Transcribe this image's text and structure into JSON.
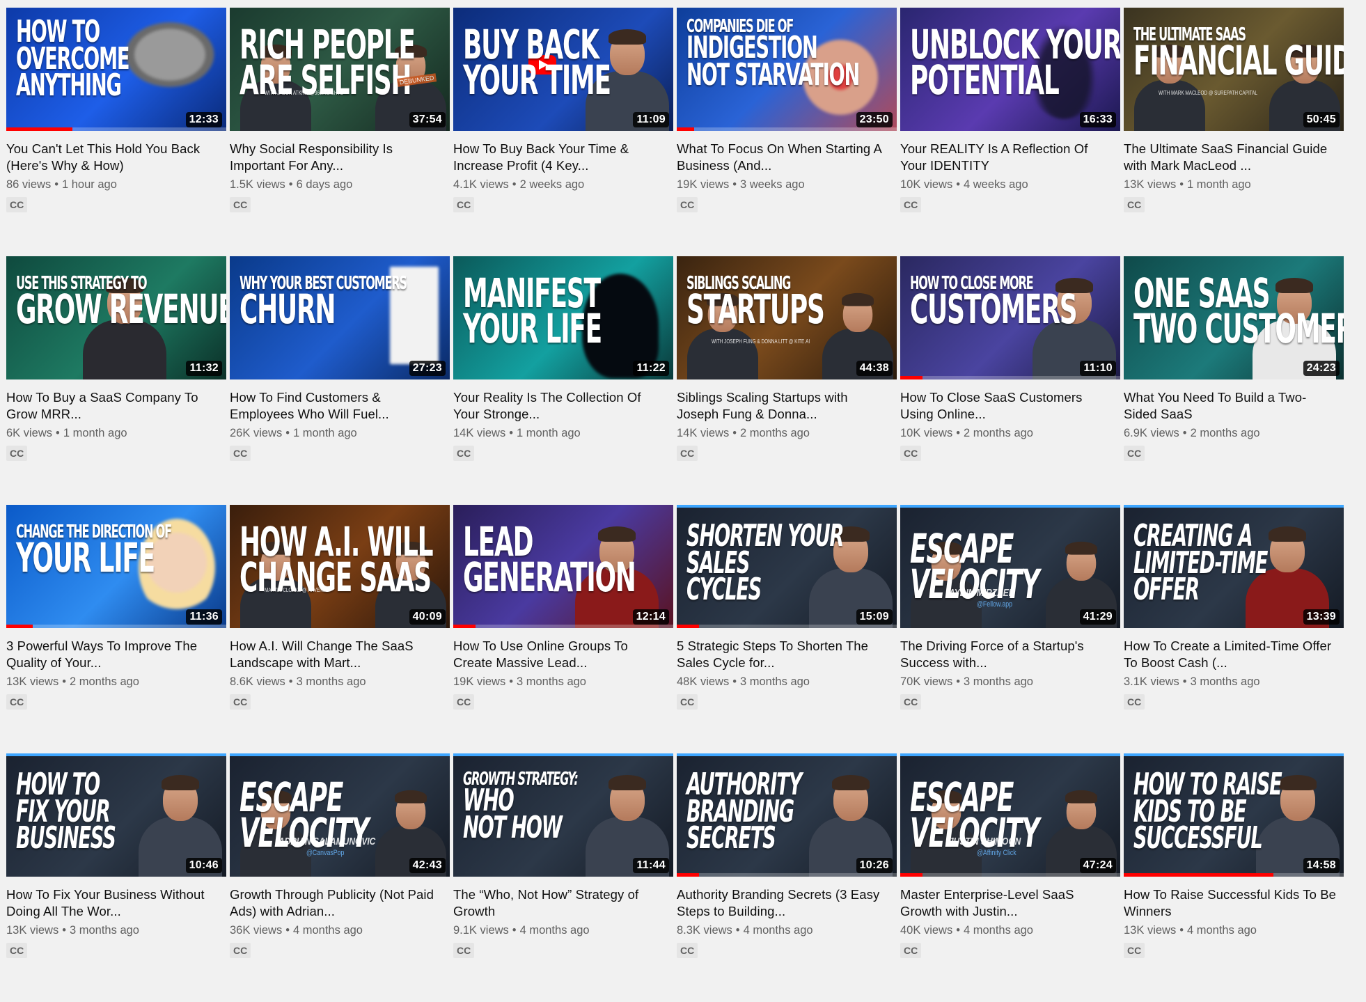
{
  "videos": [
    {
      "title": "You Can't Let This Hold You Back (Here's Why & How)",
      "views": "86 views",
      "age": "1 hour ago",
      "duration": "12:33",
      "cc": "CC",
      "thumb_lines": [
        "HOW TO",
        "OVERCOME",
        "ANYTHING"
      ],
      "thumb_credit": "",
      "progress": 0.3,
      "topline": false,
      "bg": "linear-gradient(135deg,#0d3aa8,#1e5ee8 55%,#0a2a7a)",
      "accent": "#ffffff",
      "art": "elephant"
    },
    {
      "title": "Why Social Responsibility Is Important For Any...",
      "views": "1.5K views",
      "age": "6 days ago",
      "duration": "37:54",
      "cc": "CC",
      "thumb_lines": [
        "RICH PEOPLE",
        "ARE SELFISH"
      ],
      "thumb_credit": "WITH JASON ATKINS @360INSIGHTS",
      "progress": 0,
      "topline": false,
      "bg": "linear-gradient(135deg,#1b3b2f,#2e5a45 50%,#14281f)",
      "accent": "#ffffff",
      "art": "two",
      "badge": "DEBUNKED"
    },
    {
      "title": "How To Buy Back Your Time & Increase Profit (4 Key...",
      "views": "4.1K views",
      "age": "2 weeks ago",
      "duration": "11:09",
      "cc": "CC",
      "thumb_lines": [
        "BUY BACK",
        "YOUR TIME"
      ],
      "thumb_credit": "",
      "progress": 0,
      "topline": false,
      "bg": "linear-gradient(135deg,#0c2c7a,#1d4bb8 60%,#0b1f55)",
      "accent": "#ffffff",
      "art": "man-right"
    },
    {
      "title": "What To Focus On When Starting A Business (And...",
      "views": "19K views",
      "age": "3 weeks ago",
      "duration": "23:50",
      "cc": "CC",
      "thumb_lines": [
        "COMPANIES DIE OF",
        "INDIGESTION",
        "NOT STARVATION"
      ],
      "thumb_credit": "",
      "progress": 0.08,
      "topline": false,
      "bg": "linear-gradient(135deg,#0e3e9a,#2a63d6 50%,#b04a5a)",
      "accent": "#ffffff",
      "art": "stomach"
    },
    {
      "title": "Your REALITY Is A Reflection Of Your IDENTITY",
      "views": "10K views",
      "age": "4 weeks ago",
      "duration": "16:33",
      "cc": "CC",
      "thumb_lines": [
        "UNBLOCK YOUR",
        "POTENTIAL"
      ],
      "thumb_credit": "",
      "progress": 0,
      "topline": false,
      "bg": "linear-gradient(135deg,#2a2670,#5a3bb0 55%,#1c1850)",
      "accent": "#ffffff",
      "art": "rabbit"
    },
    {
      "title": "The Ultimate SaaS Financial Guide with Mark MacLeod ...",
      "views": "13K views",
      "age": "1 month ago",
      "duration": "50:45",
      "cc": "CC",
      "thumb_lines": [
        "THE ULTIMATE SAAS",
        "FINANCIAL GUIDE"
      ],
      "thumb_credit": "WITH MARK MACLEOD @ SUREPATH CAPITAL",
      "progress": 0,
      "topline": false,
      "bg": "linear-gradient(135deg,#3a3320,#6a5a30 50%,#2a2418)",
      "accent": "#ffffff",
      "art": "two"
    },
    {
      "title": "How To Buy a SaaS Company To Grow MRR...",
      "views": "6K views",
      "age": "1 month ago",
      "duration": "11:32",
      "cc": "CC",
      "thumb_lines": [
        "USE THIS STRATEGY TO",
        "GROW REVENUE"
      ],
      "thumb_credit": "",
      "progress": 0,
      "topline": false,
      "bg": "linear-gradient(135deg,#0f4a3e,#1e7a62 55%,#0b3028)",
      "accent": "#ffffff",
      "art": "man-center"
    },
    {
      "title": "How To Find Customers & Employees Who Will Fuel...",
      "views": "26K views",
      "age": "1 month ago",
      "duration": "27:23",
      "cc": "CC",
      "thumb_lines": [
        "WHY YOUR BEST CUSTOMERS",
        "CHURN"
      ],
      "thumb_credit": "",
      "progress": 0,
      "topline": false,
      "bg": "linear-gradient(135deg,#0a3a8a,#1f5ccc 55%,#0a2a66)",
      "accent": "#ffffff",
      "art": "door"
    },
    {
      "title": "Your Reality Is The Collection Of Your Stronge...",
      "views": "14K views",
      "age": "1 month ago",
      "duration": "11:22",
      "cc": "CC",
      "thumb_lines": [
        "MANIFEST",
        "YOUR LIFE"
      ],
      "thumb_credit": "",
      "progress": 0,
      "topline": false,
      "bg": "linear-gradient(135deg,#0b5a5a,#13a0a0 55%,#0a3a3a)",
      "accent": "#ffffff",
      "art": "head"
    },
    {
      "title": "Siblings Scaling Startups with Joseph Fung & Donna...",
      "views": "14K views",
      "age": "2 months ago",
      "duration": "44:38",
      "cc": "CC",
      "thumb_lines": [
        "SIBLINGS SCALING",
        "STARTUPS"
      ],
      "thumb_credit": "WITH JOSEPH FUNG & DONNA LITT @ KITE.AI",
      "progress": 0,
      "topline": false,
      "bg": "linear-gradient(135deg,#3a2410,#7a4a1c 50%,#2a1a0c)",
      "accent": "#ffffff",
      "art": "two"
    },
    {
      "title": "How To Close SaaS Customers Using Online...",
      "views": "10K views",
      "age": "2 months ago",
      "duration": "11:10",
      "cc": "CC",
      "thumb_lines": [
        "HOW TO CLOSE MORE",
        "CUSTOMERS"
      ],
      "thumb_credit": "",
      "progress": 0.1,
      "topline": false,
      "bg": "linear-gradient(135deg,#2a2860,#4a44a0 55%,#1c1a44)",
      "accent": "#ffffff",
      "art": "man-right"
    },
    {
      "title": "What You Need To Build a Two-Sided SaaS",
      "views": "6.9K views",
      "age": "2 months ago",
      "duration": "24:23",
      "cc": "CC",
      "thumb_lines": [
        "ONE SAAS",
        "TWO CUSTOMERS"
      ],
      "thumb_credit": "",
      "progress": 0,
      "topline": false,
      "bg": "linear-gradient(135deg,#0f4a4a,#1c7a7a 55%,#0b3030)",
      "accent": "#ffffff",
      "art": "face"
    },
    {
      "title": "3 Powerful Ways To Improve The Quality of Your...",
      "views": "13K views",
      "age": "2 months ago",
      "duration": "11:36",
      "cc": "CC",
      "thumb_lines": [
        "CHANGE THE DIRECTION OF",
        "YOUR LIFE"
      ],
      "thumb_credit": "",
      "progress": 0.12,
      "topline": false,
      "bg": "linear-gradient(135deg,#0b5ac8,#2f8cf0 55%,#0a3a8a)",
      "accent": "#ffffff",
      "art": "woman"
    },
    {
      "title": "How A.I. Will Change The SaaS Landscape with Mart...",
      "views": "8.6K views",
      "age": "3 months ago",
      "duration": "40:09",
      "cc": "CC",
      "thumb_lines": [
        "HOW A.I. WILL",
        "CHANGE SAAS"
      ],
      "thumb_credit": "MARTIN CLOAKE @ RAVEN.AI",
      "progress": 0,
      "topline": false,
      "bg": "linear-gradient(135deg,#3a1e0c,#7a3e14 50%,#2a160a)",
      "accent": "#ffffff",
      "art": "two"
    },
    {
      "title": "How To Use Online Groups To Create Massive Lead...",
      "views": "19K views",
      "age": "3 months ago",
      "duration": "12:14",
      "cc": "CC",
      "thumb_lines": [
        "LEAD",
        "GENERATION"
      ],
      "thumb_credit": "",
      "progress": 0.1,
      "topline": false,
      "bg": "linear-gradient(135deg,#2a1e5a,#4a3aa0 50%,#5a1220)",
      "accent": "#ffffff",
      "art": "man-red"
    },
    {
      "title": "5 Strategic Steps To Shorten The Sales Cycle for...",
      "views": "48K views",
      "age": "3 months ago",
      "duration": "15:09",
      "cc": "CC",
      "thumb_lines": [
        "SHORTEN YOUR",
        "SALES",
        "CYCLES"
      ],
      "thumb_credit": "",
      "progress": 0.1,
      "topline": true,
      "bg": "linear-gradient(135deg,#1a2230,#2c3848 55%,#141a24)",
      "accent": "#ffffff",
      "art": "man-right"
    },
    {
      "title": "The Driving Force of a Startup's Success with...",
      "views": "70K views",
      "age": "3 months ago",
      "duration": "41:29",
      "cc": "CC",
      "thumb_lines": [
        "ESCAPE",
        "VELOCITY"
      ],
      "thumb_credit": "AYDIN MIRZAEE",
      "thumb_sub": "@Fellow.app",
      "progress": 0,
      "topline": true,
      "bg": "linear-gradient(135deg,#1a2230,#2c3848 55%,#141a24)",
      "accent": "#ffffff",
      "art": "two"
    },
    {
      "title": "How To Create a Limited-Time Offer To Boost Cash (...",
      "views": "3.1K views",
      "age": "3 months ago",
      "duration": "13:39",
      "cc": "CC",
      "thumb_lines": [
        "CREATING A",
        "LIMITED-TIME",
        "OFFER"
      ],
      "thumb_credit": "",
      "progress": 0,
      "topline": true,
      "bg": "linear-gradient(135deg,#1a2230,#2c3848 55%,#141a24)",
      "accent": "#ffffff",
      "art": "man-red"
    },
    {
      "title": "How To Fix Your Business Without Doing All The Wor...",
      "views": "13K views",
      "age": "3 months ago",
      "duration": "10:46",
      "cc": "CC",
      "thumb_lines": [
        "HOW TO",
        "FIX YOUR",
        "BUSINESS"
      ],
      "thumb_credit": "",
      "progress": 0,
      "topline": true,
      "bg": "linear-gradient(135deg,#1a2230,#2c3848 55%,#141a24)",
      "accent": "#ffffff",
      "art": "man-right"
    },
    {
      "title": "Growth Through Publicity (Not Paid Ads) with Adrian...",
      "views": "36K views",
      "age": "4 months ago",
      "duration": "42:43",
      "cc": "CC",
      "thumb_lines": [
        "ESCAPE",
        "VELOCITY"
      ],
      "thumb_credit": "ADRIAN SALAMUNOVIC",
      "thumb_sub": "@CanvasPop",
      "progress": 0,
      "topline": true,
      "bg": "linear-gradient(135deg,#1a2230,#2c3848 55%,#141a24)",
      "accent": "#ffffff",
      "art": "two"
    },
    {
      "title": "The “Who, Not How” Strategy of Growth",
      "views": "9.1K views",
      "age": "4 months ago",
      "duration": "11:44",
      "cc": "CC",
      "thumb_lines": [
        "GROWTH STRATEGY:",
        "WHO",
        "NOT HOW"
      ],
      "thumb_credit": "",
      "progress": 0,
      "topline": true,
      "bg": "linear-gradient(135deg,#1a2230,#2c3848 55%,#141a24)",
      "accent": "#ffffff",
      "art": "man-right"
    },
    {
      "title": "Authority Branding Secrets (3 Easy Steps to Building...",
      "views": "8.3K views",
      "age": "4 months ago",
      "duration": "10:26",
      "cc": "CC",
      "thumb_lines": [
        "AUTHORITY",
        "BRANDING",
        "SECRETS"
      ],
      "thumb_credit": "",
      "progress": 0.1,
      "topline": true,
      "bg": "linear-gradient(135deg,#1a2230,#2c3848 55%,#141a24)",
      "accent": "#ffffff",
      "art": "man-right"
    },
    {
      "title": "Master Enterprise-Level SaaS Growth with Justin...",
      "views": "40K views",
      "age": "4 months ago",
      "duration": "47:24",
      "cc": "CC",
      "thumb_lines": [
        "ESCAPE",
        "VELOCITY"
      ],
      "thumb_credit": "JUSTIN SHIMOON",
      "thumb_sub": "@Affinity Click",
      "progress": 0.1,
      "topline": true,
      "bg": "linear-gradient(135deg,#1a2230,#2c3848 55%,#141a24)",
      "accent": "#ffffff",
      "art": "two"
    },
    {
      "title": "How To Raise Successful Kids To Be Winners",
      "views": "13K views",
      "age": "4 months ago",
      "duration": "14:58",
      "cc": "CC",
      "thumb_lines": [
        "HOW TO RAISE",
        "KIDS TO BE",
        "SUCCESSFUL"
      ],
      "thumb_credit": "",
      "progress": 0.68,
      "topline": true,
      "bg": "linear-gradient(135deg,#1a2230,#2c3848 55%,#141a24)",
      "accent": "#ffffff",
      "art": "man-right"
    }
  ],
  "colors": {
    "progress": "#ff0000",
    "topline": "#3ea6ff",
    "meta": "#606060",
    "page_bg": "#f1f1f1"
  }
}
